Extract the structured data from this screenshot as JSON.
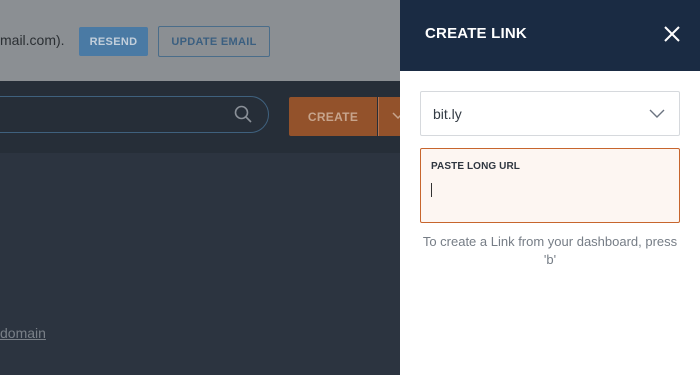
{
  "background": {
    "email_text": "mail.com).",
    "resend_label": "RESEND",
    "update_email_label": "UPDATE EMAIL",
    "create_label": "CREATE",
    "domain_link_text": " domain"
  },
  "panel": {
    "title": "CREATE LINK",
    "domain": {
      "selected": "bit.ly"
    },
    "long_url": {
      "label": "PASTE LONG URL",
      "value": ""
    },
    "hint": "To create a Link from your dashboard, press 'b'"
  },
  "colors": {
    "header": "#1a2b43",
    "accent": "#c7652d",
    "input_bg": "#fdf6f2"
  },
  "icons": {
    "close": "close-icon",
    "chevron": "chevron-down-icon",
    "search": "search-icon"
  }
}
